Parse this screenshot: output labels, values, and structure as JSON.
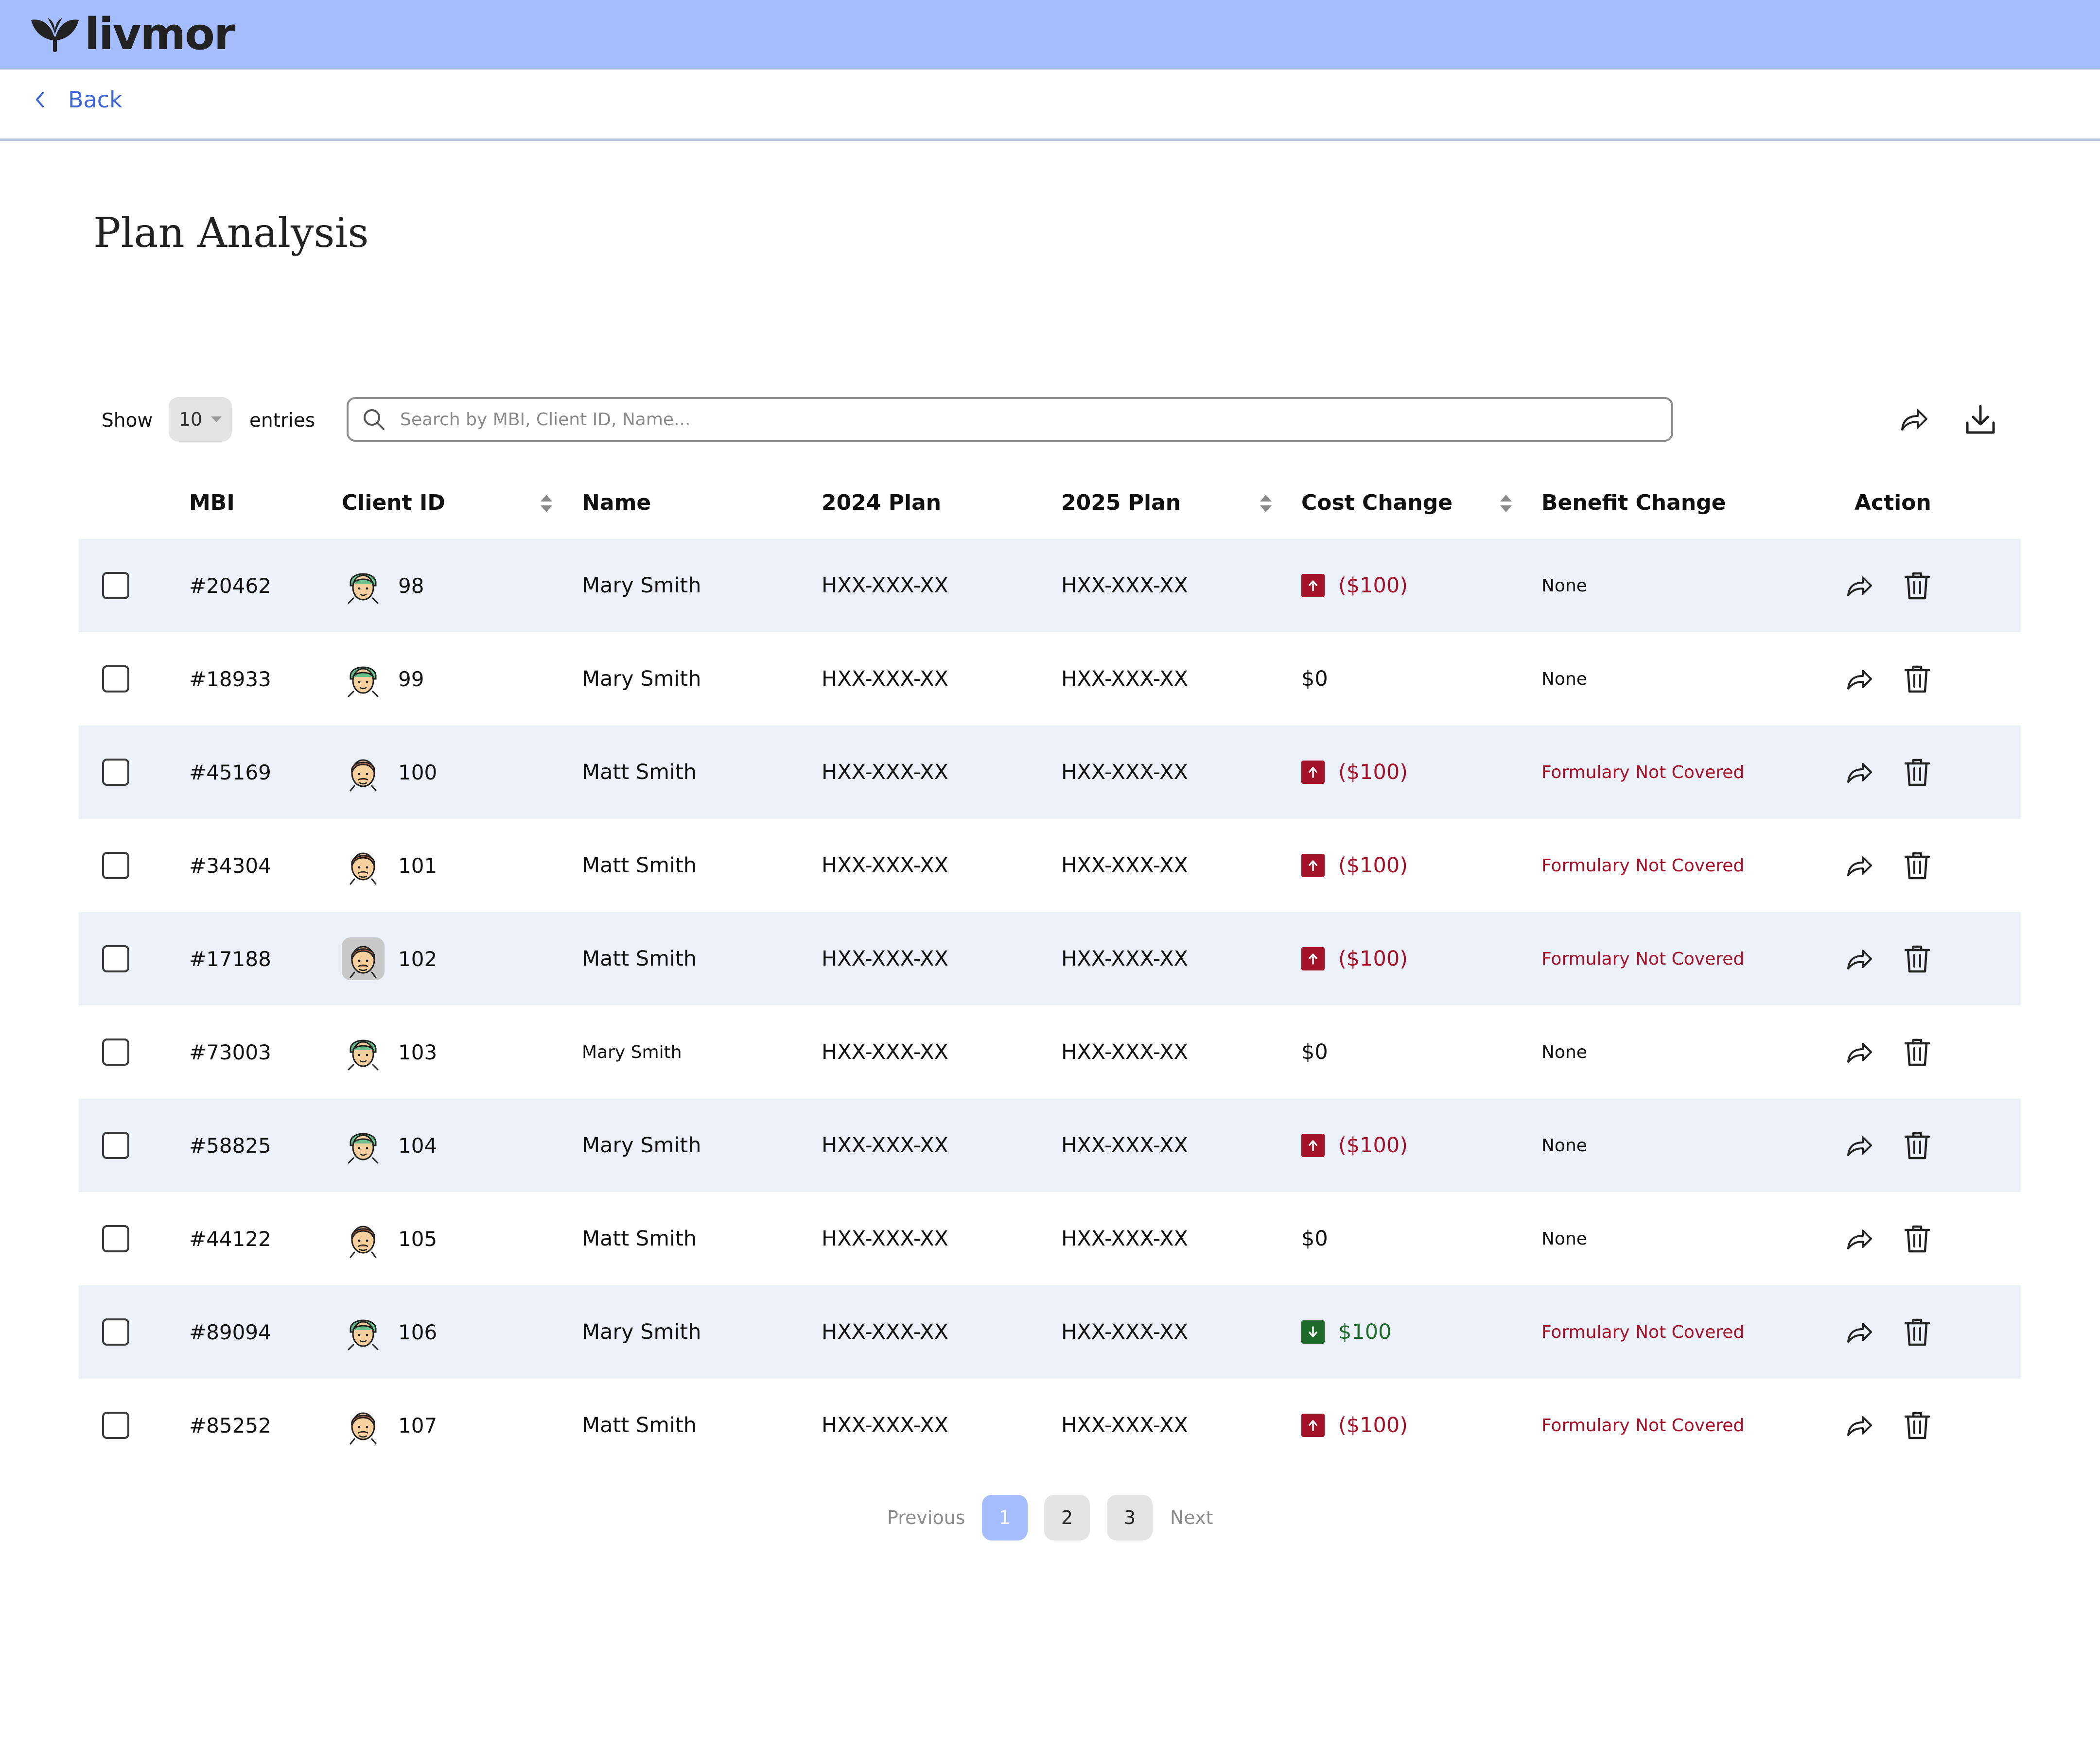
{
  "brand": {
    "name": "livmor",
    "header_color": "#a5bdfd",
    "accent": "#3f66d6"
  },
  "nav": {
    "back_label": "Back"
  },
  "page": {
    "title": "Plan Analysis"
  },
  "controls": {
    "show_label": "Show",
    "entries_value": "10",
    "entries_label": "entries",
    "search_placeholder": "Search by MBI, Client ID, Name...",
    "share_icon": "share-icon",
    "download_icon": "download-icon"
  },
  "table": {
    "headers": {
      "mbi": "MBI",
      "client_id": "Client ID",
      "name": "Name",
      "plan_2024": "2024 Plan",
      "plan_2025": "2025 Plan",
      "cost_change": "Cost Change",
      "benefit_change": "Benefit Change",
      "action": "Action"
    },
    "rows": [
      {
        "mbi": "#20462",
        "avatar": "female",
        "client_id": "98",
        "name": "Mary Smith",
        "plan_2024": "HXX-XXX-XX",
        "plan_2025": "HXX-XXX-XX",
        "cost": "($100)",
        "cost_trend": "up",
        "benefit": "None"
      },
      {
        "mbi": "#18933",
        "avatar": "female",
        "client_id": "99",
        "name": "Mary Smith",
        "plan_2024": "HXX-XXX-XX",
        "plan_2025": "HXX-XXX-XX",
        "cost": "$0",
        "cost_trend": "none",
        "benefit": "None"
      },
      {
        "mbi": "#45169",
        "avatar": "male",
        "client_id": "100",
        "name": "Matt Smith",
        "plan_2024": "HXX-XXX-XX",
        "plan_2025": "HXX-XXX-XX",
        "cost": "($100)",
        "cost_trend": "up",
        "benefit": "Formulary Not Covered"
      },
      {
        "mbi": "#34304",
        "avatar": "male",
        "client_id": "101",
        "name": "Matt Smith",
        "plan_2024": "HXX-XXX-XX",
        "plan_2025": "HXX-XXX-XX",
        "cost": "($100)",
        "cost_trend": "up",
        "benefit": "Formulary Not Covered"
      },
      {
        "mbi": "#17188",
        "avatar": "male",
        "client_id": "102",
        "name": "Matt Smith",
        "plan_2024": "HXX-XXX-XX",
        "plan_2025": "HXX-XXX-XX",
        "cost": "($100)",
        "cost_trend": "up",
        "benefit": "Formulary Not Covered",
        "avatar_selected": true
      },
      {
        "mbi": "#73003",
        "avatar": "female",
        "client_id": "103",
        "name": "Mary Smith",
        "plan_2024": "HXX-XXX-XX",
        "plan_2025": "HXX-XXX-XX",
        "cost": "$0",
        "cost_trend": "none",
        "benefit": "None"
      },
      {
        "mbi": "#58825",
        "avatar": "female",
        "client_id": "104",
        "name": "Mary Smith",
        "plan_2024": "HXX-XXX-XX",
        "plan_2025": "HXX-XXX-XX",
        "cost": "($100)",
        "cost_trend": "up",
        "benefit": "None"
      },
      {
        "mbi": "#44122",
        "avatar": "male",
        "client_id": "105",
        "name": "Matt Smith",
        "plan_2024": "HXX-XXX-XX",
        "plan_2025": "HXX-XXX-XX",
        "cost": "$0",
        "cost_trend": "none",
        "benefit": "None"
      },
      {
        "mbi": "#89094",
        "avatar": "female",
        "client_id": "106",
        "name": "Mary Smith",
        "plan_2024": "HXX-XXX-XX",
        "plan_2025": "HXX-XXX-XX",
        "cost": "$100",
        "cost_trend": "down",
        "benefit": "Formulary Not Covered"
      },
      {
        "mbi": "#85252",
        "avatar": "male",
        "client_id": "107",
        "name": "Matt Smith",
        "plan_2024": "HXX-XXX-XX",
        "plan_2025": "HXX-XXX-XX",
        "cost": "($100)",
        "cost_trend": "up",
        "benefit": "Formulary Not Covered"
      }
    ],
    "colors": {
      "negative": "#a4122a",
      "positive": "#1f6b2a",
      "alt_row": "#ecf0f8"
    }
  },
  "pagination": {
    "previous": "Previous",
    "next": "Next",
    "pages": [
      "1",
      "2",
      "3"
    ],
    "current": "1"
  }
}
